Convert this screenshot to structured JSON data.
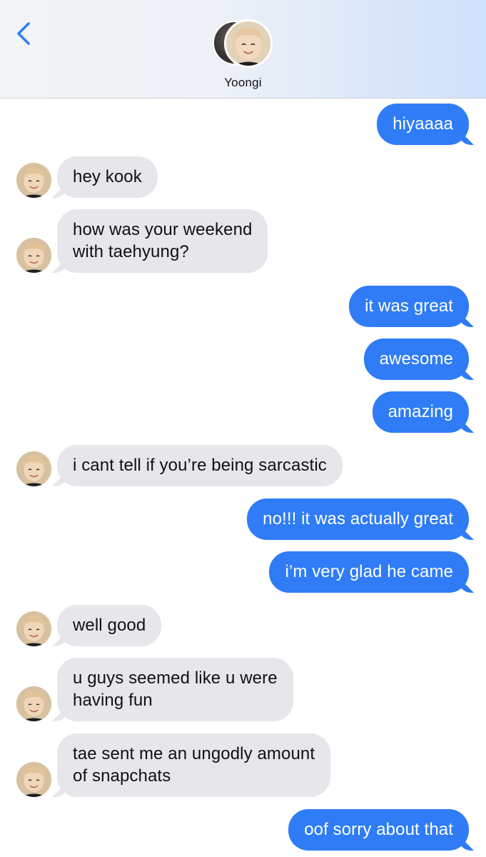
{
  "contact": {
    "name": "Yoongi"
  },
  "messages": [
    {
      "from": "me",
      "text": "hiyaaaa"
    },
    {
      "from": "them",
      "text": "hey kook"
    },
    {
      "from": "them",
      "text": "how was your weekend\nwith taehyung?"
    },
    {
      "from": "me",
      "text": "it was great"
    },
    {
      "from": "me",
      "text": "awesome"
    },
    {
      "from": "me",
      "text": "amazing"
    },
    {
      "from": "them",
      "text": "i cant tell if you’re being sarcastic"
    },
    {
      "from": "me",
      "text": "no!!! it was actually great"
    },
    {
      "from": "me",
      "text": "i’m very glad he came"
    },
    {
      "from": "them",
      "text": "well good"
    },
    {
      "from": "them",
      "text": "u guys seemed like u were\nhaving fun"
    },
    {
      "from": "them",
      "text": "tae sent me an ungodly amount\nof snapchats"
    },
    {
      "from": "me",
      "text": "oof sorry about that"
    }
  ],
  "colors": {
    "outgoing": "#2f7cf6",
    "incoming": "#e6e6eb",
    "accent": "#2f7cf6"
  },
  "icons": {
    "back": "chevron-left-icon",
    "avatar": "contact-avatar"
  }
}
